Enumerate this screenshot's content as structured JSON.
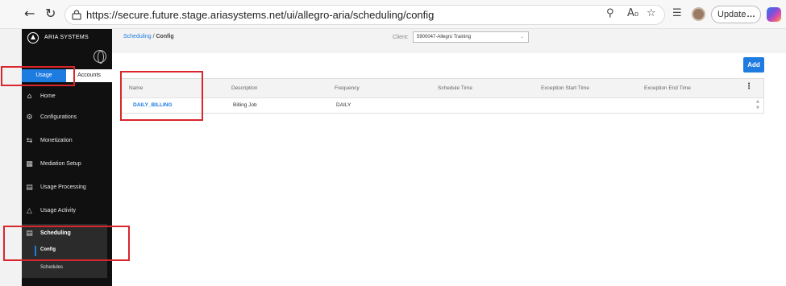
{
  "browser": {
    "back_icon": "back-arrow-icon",
    "refresh_icon": "refresh-icon",
    "url": "https://secure.future.stage.ariasystems.net/ui/allegro-aria/scheduling/config",
    "update_label": "Update",
    "more_label": "…"
  },
  "sidebar": {
    "brand": "ARIA SYSTEMS",
    "tabs": {
      "usage": "Usage",
      "accounts": "Accounts"
    },
    "items": [
      {
        "label": "Home",
        "icon": "home-icon"
      },
      {
        "label": "Configurations",
        "icon": "gears-icon"
      },
      {
        "label": "Monetization",
        "icon": "arrows-icon"
      },
      {
        "label": "Mediation Setup",
        "icon": "grid-icon"
      },
      {
        "label": "Usage Processing",
        "icon": "process-icon"
      },
      {
        "label": "Usage Activity",
        "icon": "chart-icon"
      },
      {
        "label": "Scheduling",
        "icon": "schedule-icon"
      }
    ],
    "sub_items": [
      {
        "label": "Config"
      },
      {
        "label": "Schedules"
      }
    ]
  },
  "header": {
    "breadcrumb_link": "Scheduling",
    "breadcrumb_sep": "/",
    "breadcrumb_current": "Config",
    "client_label": "Client:",
    "client_value": "5900047-Allegro Training"
  },
  "main": {
    "add_label": "Add",
    "columns": [
      "Name",
      "Description",
      "Frequency",
      "Schedule Time",
      "Exception Start Time",
      "Exception End Time"
    ],
    "rows": [
      {
        "name": "DAILY_BILLING",
        "description": "Billing Job",
        "frequency": "DAILY",
        "schedule_time": "",
        "exception_start": "",
        "exception_end": ""
      }
    ]
  },
  "colors": {
    "accent": "#1e7be0",
    "highlight": "#d9262c",
    "sidebar_bg": "#101010"
  }
}
